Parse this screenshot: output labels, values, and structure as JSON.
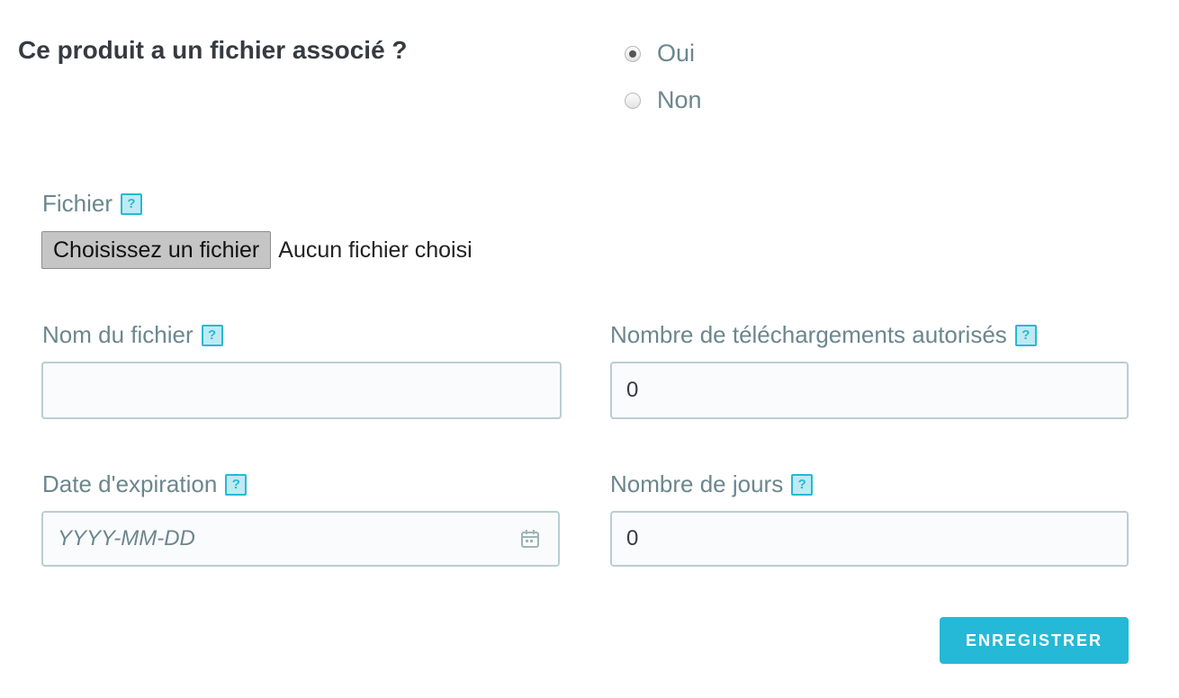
{
  "question": "Ce produit a un fichier associé ?",
  "options": {
    "yes": "Oui",
    "no": "Non",
    "selected": "Oui"
  },
  "file": {
    "label": "Fichier",
    "button": "Choisissez un fichier",
    "status": "Aucun fichier choisi"
  },
  "help_symbol": "?",
  "filename": {
    "label": "Nom du fichier",
    "value": ""
  },
  "downloads": {
    "label": "Nombre de téléchargements autorisés",
    "value": "0"
  },
  "expiration": {
    "label": "Date d'expiration",
    "placeholder": "YYYY-MM-DD"
  },
  "days": {
    "label": "Nombre de jours",
    "value": "0"
  },
  "save_label": "ENREGISTRER",
  "colors": {
    "accent": "#25b9d7",
    "label": "#6c868e",
    "border": "#bbcdd2"
  }
}
